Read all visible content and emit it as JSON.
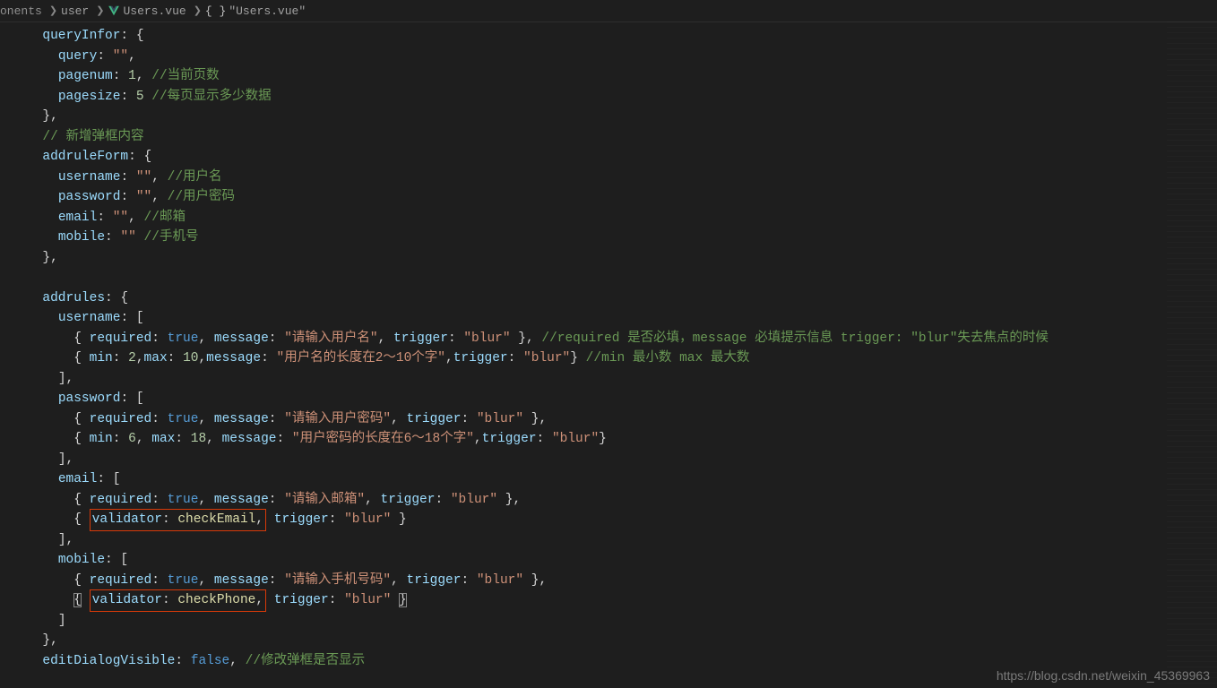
{
  "breadcrumb": {
    "seg0": "onents",
    "seg1": "user",
    "seg2": "Users.vue",
    "seg3_brace": "{ }",
    "seg3_label": "\"Users.vue\""
  },
  "watermark": "https://blog.csdn.net/weixin_45369963",
  "code": {
    "queryInfor": {
      "key": "queryInfor",
      "query_key": "query",
      "query_val": "\"\"",
      "pagenum_key": "pagenum",
      "pagenum_val": "1",
      "pagenum_cm": "//当前页数",
      "pagesize_key": "pagesize",
      "pagesize_val": "5",
      "pagesize_cm": "//每页显示多少数据"
    },
    "addruleForm_cm": "// 新增弹框内容",
    "addruleForm": {
      "key": "addruleForm",
      "username_key": "username",
      "username_val": "\"\"",
      "username_cm": "//用户名",
      "password_key": "password",
      "password_val": "\"\"",
      "password_cm": "//用户密码",
      "email_key": "email",
      "email_val": "\"\"",
      "email_cm": "//邮箱",
      "mobile_key": "mobile",
      "mobile_val": "\"\"",
      "mobile_cm": "//手机号"
    },
    "addrules": {
      "key": "addrules",
      "username_key": "username",
      "username_r1": {
        "required_key": "required",
        "required_val": "true",
        "message_key": "message",
        "message_val": "\"请输入用户名\"",
        "trigger_key": "trigger",
        "trigger_val": "\"blur\"",
        "cm": "//required  是否必填，message 必填提示信息 trigger: \"blur\"失去焦点的时候"
      },
      "username_r2": {
        "min_kv": "min: 2",
        "max_kv": "max: 10",
        "message_key": "message",
        "message_val": "\"用户名的长度在2～10个字\"",
        "trigger_key": "trigger",
        "trigger_val": "\"blur\"",
        "cm": "//min 最小数 max 最大数",
        "min_key": "min",
        "min_val": "2",
        "max_key": "max",
        "max_val": "10"
      },
      "password_key": "password",
      "password_r1": {
        "required_key": "required",
        "required_val": "true",
        "message_key": "message",
        "message_val": "\"请输入用户密码\"",
        "trigger_key": "trigger",
        "trigger_val": "\"blur\""
      },
      "password_r2": {
        "min_key": "min",
        "min_val": "6",
        "max_key": "max",
        "max_val": "18",
        "message_key": "message",
        "message_val": "\"用户密码的长度在6～18个字\"",
        "trigger_key": "trigger",
        "trigger_val": "\"blur\""
      },
      "email_key": "email",
      "email_r1": {
        "required_key": "required",
        "required_val": "true",
        "message_key": "message",
        "message_val": "\"请输入邮箱\"",
        "trigger_key": "trigger",
        "trigger_val": "\"blur\""
      },
      "email_r2": {
        "validator_key": "validator",
        "validator_val": "checkEmail",
        "trigger_key": "trigger",
        "trigger_val": "\"blur\""
      },
      "mobile_key": "mobile",
      "mobile_r1": {
        "required_key": "required",
        "required_val": "true",
        "message_key": "message",
        "message_val": "\"请输入手机号码\"",
        "trigger_key": "trigger",
        "trigger_val": "\"blur\""
      },
      "mobile_r2": {
        "validator_key": "validator",
        "validator_val": "checkPhone",
        "trigger_key": "trigger",
        "trigger_val": "\"blur\""
      }
    },
    "editDialogVisible": {
      "key": "editDialogVisible",
      "val": "false",
      "cm": "//修改弹框是否显示"
    }
  }
}
